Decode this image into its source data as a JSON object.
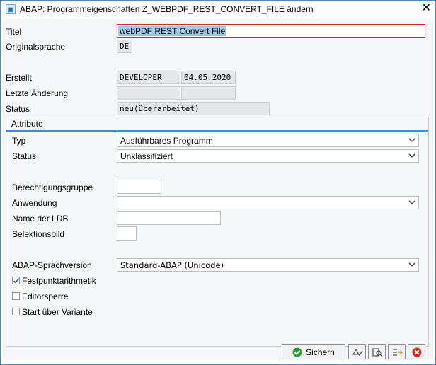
{
  "window": {
    "title": "ABAP: Programmeigenschaften Z_WEBPDF_REST_CONVERT_FILE ändern",
    "close_glyph": "✕"
  },
  "header_fields": {
    "titel_label": "Titel",
    "titel_value": "webPDF REST Convert File",
    "originalsprache_label": "Originalsprache",
    "originalsprache_value": "DE",
    "erstellt_label": "Erstellt",
    "erstellt_user": "DEVELOPER",
    "erstellt_date": "04.05.2020",
    "letzte_aenderung_label": "Letzte Änderung",
    "letzte_aenderung_user": "",
    "letzte_aenderung_date": "",
    "status_label": "Status",
    "status_value": "neu(überarbeitet)"
  },
  "attribute": {
    "group_title": "Attribute",
    "typ_label": "Typ",
    "typ_value": "Ausführbares Programm",
    "status_label": "Status",
    "status_value": "Unklassifiziert",
    "berechtigungsgruppe_label": "Berechtigungsgruppe",
    "berechtigungsgruppe_value": "",
    "anwendung_label": "Anwendung",
    "anwendung_value": "",
    "name_ldb_label": "Name der LDB",
    "name_ldb_value": "",
    "selektionsbild_label": "Selektionsbild",
    "selektionsbild_value": "",
    "sprachversion_label": "ABAP-Sprachversion",
    "sprachversion_value": "Standard-ABAP (Unicode)",
    "checkboxes": [
      {
        "label": "Festpunktarithmetik",
        "checked": true
      },
      {
        "label": "Editorsperre",
        "checked": false
      },
      {
        "label": "Start über Variante",
        "checked": false
      }
    ]
  },
  "toolbar": {
    "save_label": "Sichern",
    "icons": [
      "check-icon",
      "where-used-icon",
      "find-icon",
      "transfer-icon",
      "cancel-icon"
    ]
  },
  "colors": {
    "accent": "#3c8fd6",
    "save_green": "#2e9e3a",
    "cancel_red": "#d62a2a"
  }
}
